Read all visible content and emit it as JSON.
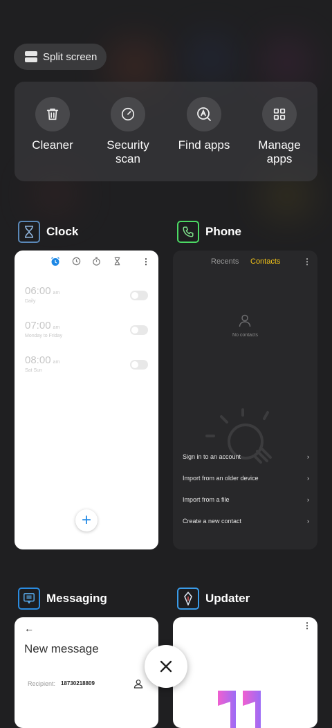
{
  "split_screen": {
    "label": "Split screen"
  },
  "tools": [
    {
      "label": "Cleaner",
      "icon": "trash-icon"
    },
    {
      "label": "Security\nscan",
      "icon": "security-scan-icon"
    },
    {
      "label": "Find apps",
      "icon": "find-apps-icon"
    },
    {
      "label": "Manage\napps",
      "icon": "grid-icon"
    }
  ],
  "apps": {
    "clock": {
      "name": "Clock",
      "alarms": [
        {
          "time": "06:00",
          "ampm": "am",
          "days": "Daily"
        },
        {
          "time": "07:00",
          "ampm": "am",
          "days": "Monday to Friday"
        },
        {
          "time": "08:00",
          "ampm": "am",
          "days": "Sat Sun"
        }
      ],
      "fab": "+"
    },
    "phone": {
      "name": "Phone",
      "tabs": {
        "recents": "Recents",
        "contacts": "Contacts"
      },
      "empty": "No contacts",
      "options": [
        "Sign in to an account",
        "Import from an older device",
        "Import from a file",
        "Create a new contact"
      ]
    },
    "messaging": {
      "name": "Messaging",
      "title": "New message",
      "recipient_label": "Recipient:",
      "recipient_value": "18730218809"
    },
    "updater": {
      "name": "Updater"
    }
  },
  "colors": {
    "accent_blue": "#1e88e5",
    "contacts_tab": "#f5c518",
    "phone_icon_border": "#4cd964",
    "clock_icon_border": "#5a88b8",
    "messaging_icon_border": "#2a8be0",
    "updater_icon_border": "#3a9be8"
  }
}
